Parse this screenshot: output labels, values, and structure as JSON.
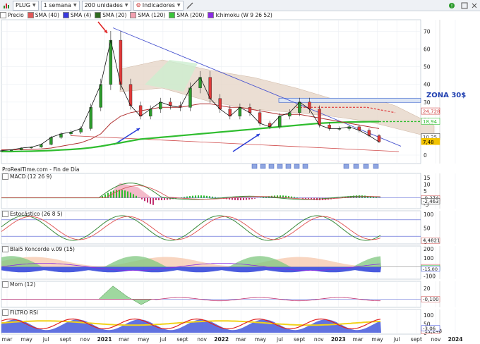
{
  "toolbar": {
    "ticker": "PLUG",
    "period": "1 semana",
    "units": "200 unidades",
    "indicators": "Indicadores"
  },
  "legend": [
    {
      "label": "Precio",
      "color": "#ffffff"
    },
    {
      "label": "SMA (40)",
      "color": "#e05a5a"
    },
    {
      "label": "SMA (4)",
      "color": "#3a3adf"
    },
    {
      "label": "SMA (20)",
      "color": "#2f6b1f"
    },
    {
      "label": "SMA (120)",
      "color": "#f3a0b0"
    },
    {
      "label": "SMA (200)",
      "color": "#3ac43a"
    },
    {
      "label": "Ichimoku (W 9 26 52)",
      "color": "#8a2be2"
    }
  ],
  "source": "ProRealTime.com - Fin de Día",
  "annotation": "ZONA 30$",
  "panels": {
    "macd": "MACD (12 26 9)",
    "stoch": "Estocástico (26 8 5)",
    "koncorde": "Blai5 Koncorde v.09 (15)",
    "mom": "Mom (12)",
    "rsi": "FILTRO RSI"
  },
  "price_axis": {
    "ticks": [
      "70",
      "60",
      "50",
      "40",
      "30",
      "20",
      "10",
      "0"
    ]
  },
  "price_tags": [
    "24,728",
    "18,94",
    "10,25",
    "7,48"
  ],
  "macd_axis": {
    "ticks": [
      "15",
      "10",
      "5",
      "0",
      "-5"
    ],
    "tags": [
      "-0,274",
      "-2,463"
    ]
  },
  "stoch_axis": {
    "ticks": [
      "100",
      "50",
      "0"
    ],
    "tags": [
      "4,4821"
    ]
  },
  "koncorde_axis": {
    "ticks": [
      "200",
      "100",
      "0",
      "-100"
    ],
    "tags": [
      "-3,711",
      "-13,51",
      "-15,00"
    ]
  },
  "mom_axis": {
    "ticks": [
      "20",
      "0"
    ],
    "tags": [
      "-0,100"
    ]
  },
  "rsi_axis": {
    "ticks": [
      "100",
      "50",
      "0"
    ],
    "tags": [
      "-11,248",
      "-3,06"
    ]
  },
  "x_axis": {
    "labels": [
      "mar",
      "may",
      "jul",
      "sept",
      "nov",
      "2021",
      "mar",
      "may",
      "jul",
      "sept",
      "nov",
      "2022",
      "mar",
      "may",
      "jul",
      "sept",
      "nov",
      "2023",
      "mar",
      "may",
      "jul",
      "sept",
      "nov",
      "2024"
    ]
  },
  "chart_data": {
    "type": "line",
    "title": "PLUG",
    "xlabel": "",
    "ylabel": "",
    "x": [
      "2020-03",
      "2020-04",
      "2020-05",
      "2020-06",
      "2020-07",
      "2020-08",
      "2020-09",
      "2020-10",
      "2020-11",
      "2020-12",
      "2021-01",
      "2021-02",
      "2021-03",
      "2021-04",
      "2021-05",
      "2021-06",
      "2021-07",
      "2021-08",
      "2021-09",
      "2021-10",
      "2021-11",
      "2021-12",
      "2022-01",
      "2022-02",
      "2022-03",
      "2022-04",
      "2022-05",
      "2022-06",
      "2022-07",
      "2022-08",
      "2022-09",
      "2022-10",
      "2022-11",
      "2022-12",
      "2023-01",
      "2023-02",
      "2023-03",
      "2023-04",
      "2023-05"
    ],
    "series": [
      {
        "name": "Precio",
        "values": [
          2.5,
          3,
          4,
          4.5,
          6,
          10,
          12,
          13,
          15,
          27,
          40,
          65,
          40,
          28,
          22,
          26,
          30,
          28,
          27,
          38,
          44,
          32,
          26,
          22,
          27,
          24,
          18,
          16,
          22,
          24,
          30,
          26,
          17,
          15,
          15,
          16,
          14,
          11,
          7.48
        ]
      },
      {
        "name": "SMA (200)",
        "values": [
          2,
          2,
          2.1,
          2.2,
          2.4,
          2.6,
          2.9,
          3.2,
          3.6,
          4.2,
          5,
          6,
          7,
          8,
          9,
          9.5,
          10,
          10.5,
          11,
          11.5,
          12,
          12.5,
          13,
          13.5,
          14,
          14.5,
          15,
          15.5,
          16,
          16.5,
          17,
          17.5,
          18,
          18.3,
          18.5,
          18.7,
          18.8,
          18.9,
          18.94
        ]
      },
      {
        "name": "SMA (40)",
        "values": [
          3,
          3,
          3,
          3.2,
          3.5,
          4,
          5,
          6,
          7,
          9,
          12,
          18,
          22,
          24,
          25,
          26,
          27,
          27,
          27,
          28,
          29,
          29,
          28,
          27,
          27,
          26,
          25,
          24,
          23,
          23,
          23,
          22,
          21,
          20,
          19,
          18,
          17,
          16,
          15
        ]
      }
    ],
    "ylim": [
      0,
      75
    ],
    "grid": true,
    "legend": "top-left"
  }
}
